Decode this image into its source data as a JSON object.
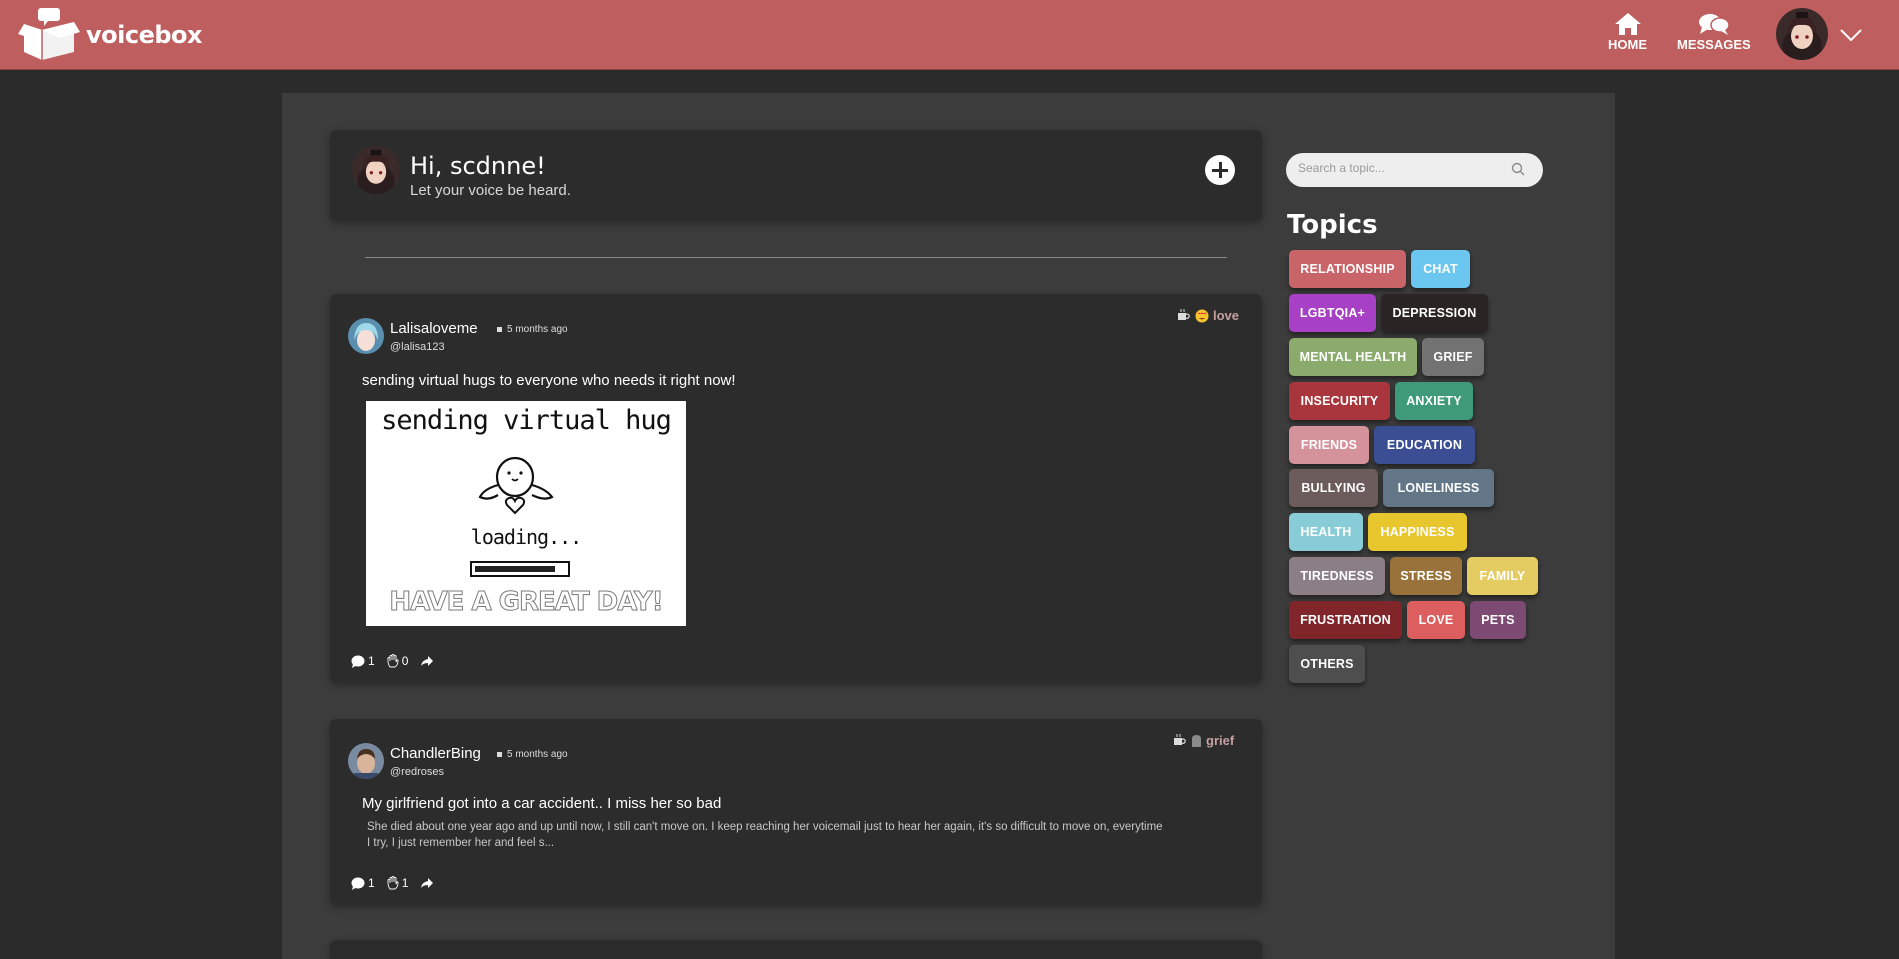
{
  "header": {
    "logo_text": "voicebox",
    "nav_home": "HOME",
    "nav_messages": "MESSAGES",
    "colors": {
      "bar": "#bf5e5e"
    }
  },
  "composer": {
    "greeting": "Hi, scdnne!",
    "subtitle": "Let your voice be heard."
  },
  "posts": [
    {
      "username": "Lalisaloveme",
      "handle": "@lalisa123",
      "time": "5 months ago",
      "tag": "love",
      "tag_icon": "heart-eyes-emoji",
      "title": "sending virtual hugs to everyone who needs it right now!",
      "image": {
        "line1": "sending virtual hug",
        "line2": "loading...",
        "line3": "HAVE A GREAT DAY!"
      },
      "comments": "1",
      "hugs": "0"
    },
    {
      "username": "ChandlerBing",
      "handle": "@redroses",
      "time": "5 months ago",
      "tag": "grief",
      "tag_icon": "gravestone-icon",
      "title": "My girlfriend got into a car accident.. I miss her so bad",
      "body": "She died about one year ago and up until now, I still can't move on. I keep reaching her voicemail just to hear her again, it's so difficult to move on, everytime I try, I just remember her and feel s...",
      "comments": "1",
      "hugs": "1"
    }
  ],
  "sidebar": {
    "search_placeholder": "Search a topic...",
    "topics_title": "Topics",
    "topics": [
      {
        "label": "RELATIONSHIP",
        "color": "#c96468"
      },
      {
        "label": "CHAT",
        "color": "#6cc7f0"
      },
      {
        "label": "LGBTQIA+",
        "color": "#a740c4"
      },
      {
        "label": "DEPRESSION",
        "color": "#2a2424"
      },
      {
        "label": "MENTAL HEALTH",
        "color": "#8aab6c"
      },
      {
        "label": "GRIEF",
        "color": "#727272"
      },
      {
        "label": "INSECURITY",
        "color": "#a8363c"
      },
      {
        "label": "ANXIETY",
        "color": "#3f9a7a"
      },
      {
        "label": "FRIENDS",
        "color": "#d4929a"
      },
      {
        "label": "EDUCATION",
        "color": "#3b4e94"
      },
      {
        "label": "BULLYING",
        "color": "#6b5b5b"
      },
      {
        "label": "LONELINESS",
        "color": "#627688"
      },
      {
        "label": "HEALTH",
        "color": "#88ccd8"
      },
      {
        "label": "HAPPINESS",
        "color": "#e8c62e"
      },
      {
        "label": "TIREDNESS",
        "color": "#8c7e86"
      },
      {
        "label": "STRESS",
        "color": "#98723a"
      },
      {
        "label": "FAMILY",
        "color": "#e4cc62"
      },
      {
        "label": "FRUSTRATION",
        "color": "#80262a"
      },
      {
        "label": "LOVE",
        "color": "#dd5e5e"
      },
      {
        "label": "PETS",
        "color": "#7c4a72"
      },
      {
        "label": "OTHERS",
        "color": "#4e4e4e"
      }
    ]
  }
}
